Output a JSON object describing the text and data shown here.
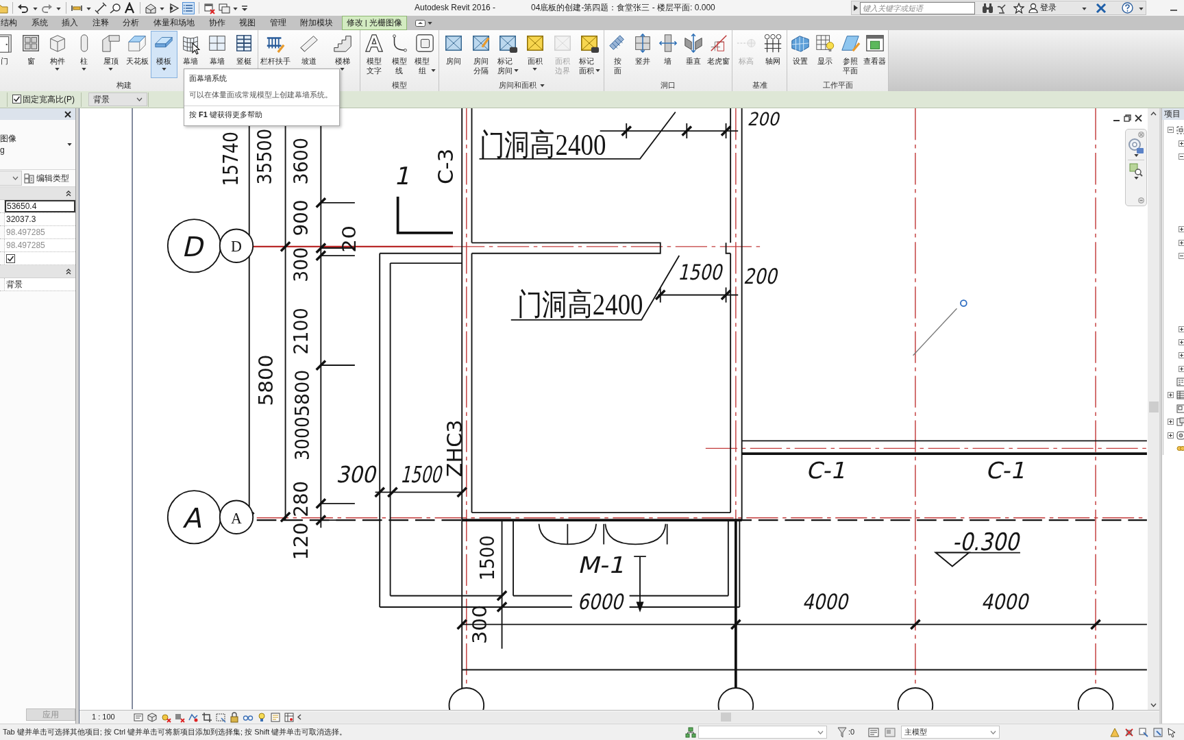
{
  "title_bar": {
    "app": "Autodesk Revit 2016 -",
    "document": "04底板的创建-第四题：食堂张三 - 楼层平面: 0.000",
    "search": {
      "placeholder": "键入关键字或短语"
    },
    "sign_in": "登录"
  },
  "ribbon_tabs": [
    {
      "label": "结构",
      "selected": false
    },
    {
      "label": "系统",
      "selected": false
    },
    {
      "label": "插入",
      "selected": false
    },
    {
      "label": "注释",
      "selected": false
    },
    {
      "label": "分析",
      "selected": false
    },
    {
      "label": "体量和场地",
      "selected": false
    },
    {
      "label": "协作",
      "selected": false
    },
    {
      "label": "视图",
      "selected": false
    },
    {
      "label": "管理",
      "selected": false
    },
    {
      "label": "附加模块",
      "selected": false
    },
    {
      "label": "修改 | 光栅图像",
      "selected": true
    }
  ],
  "ribbon_panels": [
    {
      "title": "构建",
      "has_menu": false,
      "tools": [
        {
          "label": "门",
          "has_menu": false,
          "highlighted": false,
          "disabled": false
        },
        {
          "label": "窗",
          "has_menu": false,
          "highlighted": false,
          "disabled": false
        },
        {
          "label": "构件",
          "has_menu": true,
          "highlighted": false,
          "disabled": false
        },
        {
          "label": "柱",
          "has_menu": true,
          "highlighted": false,
          "disabled": false
        },
        {
          "label": "屋顶",
          "has_menu": true,
          "highlighted": false,
          "disabled": false
        },
        {
          "label": "天花板",
          "has_menu": false,
          "highlighted": false,
          "disabled": false
        },
        {
          "label": "楼板",
          "has_menu": true,
          "highlighted": true,
          "disabled": false
        },
        {
          "label": "幕墙",
          "has_menu": false,
          "highlighted": false,
          "disabled": false
        },
        {
          "label": "幕墙",
          "has_menu": false,
          "highlighted": false,
          "disabled": false
        },
        {
          "label": "竖梃",
          "has_menu": false,
          "highlighted": false,
          "disabled": false
        }
      ]
    },
    {
      "tools": [
        {
          "label": "栏杆扶手",
          "has_menu": false,
          "highlighted": false,
          "disabled": false
        },
        {
          "label": "坡道",
          "has_menu": false,
          "highlighted": false,
          "disabled": false
        },
        {
          "label": "楼梯",
          "has_menu": true,
          "highlighted": false,
          "disabled": false
        }
      ]
    },
    {
      "title": "模型",
      "has_menu": false,
      "tools": [
        {
          "label": "模型文字",
          "has_menu": false,
          "highlighted": false,
          "disabled": false
        },
        {
          "label": "模型线",
          "has_menu": false,
          "highlighted": false,
          "disabled": false
        },
        {
          "label": "模型组",
          "has_menu": true,
          "highlighted": false,
          "disabled": false
        }
      ]
    },
    {
      "title": "房间和面积",
      "has_menu": true,
      "tools": [
        {
          "label": "房间",
          "has_menu": false,
          "highlighted": false,
          "disabled": false
        },
        {
          "label": "房间分隔",
          "has_menu": false,
          "highlighted": false,
          "disabled": false
        },
        {
          "label": "标记房间",
          "has_menu": true,
          "highlighted": false,
          "disabled": false
        },
        {
          "label": "面积",
          "has_menu": true,
          "highlighted": false,
          "disabled": false
        },
        {
          "label": "面积边界",
          "has_menu": false,
          "highlighted": false,
          "disabled": true
        },
        {
          "label": "标记面积",
          "has_menu": true,
          "highlighted": false,
          "disabled": false
        }
      ]
    },
    {
      "title": "洞口",
      "has_menu": false,
      "tools": [
        {
          "label": "按面",
          "has_menu": false,
          "highlighted": false,
          "disabled": false
        },
        {
          "label": "竖井",
          "has_menu": false,
          "highlighted": false,
          "disabled": false
        },
        {
          "label": "墙",
          "has_menu": false,
          "highlighted": false,
          "disabled": false
        },
        {
          "label": "垂直",
          "has_menu": false,
          "highlighted": false,
          "disabled": false
        },
        {
          "label": "老虎窗",
          "has_menu": false,
          "highlighted": false,
          "disabled": false
        }
      ]
    },
    {
      "title": "基准",
      "has_menu": false,
      "tools": [
        {
          "label": "标高",
          "has_menu": false,
          "highlighted": false,
          "disabled": true
        },
        {
          "label": "轴网",
          "has_menu": false,
          "highlighted": false,
          "disabled": false
        }
      ]
    },
    {
      "title": "工作平面",
      "has_menu": false,
      "tools": [
        {
          "label": "设置",
          "has_menu": false,
          "highlighted": false,
          "disabled": false
        },
        {
          "label": "显示",
          "has_menu": false,
          "highlighted": false,
          "disabled": false
        },
        {
          "label": "参照平面",
          "has_menu": false,
          "highlighted": false,
          "disabled": false
        },
        {
          "label": "查看器",
          "has_menu": false,
          "highlighted": false,
          "disabled": false
        }
      ]
    }
  ],
  "tooltip": {
    "title": "面幕墙系统",
    "description": "可以在体量面或常规模型上创建幕墙系统。",
    "help": "按 **F1** 键获得更多帮助"
  },
  "options_bar": {
    "lock_aspect": {
      "label": "固定宽高比(P)",
      "checked": true
    },
    "draw_layer": {
      "value": "背景"
    }
  },
  "properties": {
    "type_lines": [
      "图像",
      "g"
    ],
    "edit_type": "编辑类型",
    "groups": [
      {
        "expanded": true,
        "rows": [
          {
            "kind": "value",
            "value": "53650.4",
            "focused": true,
            "disabled": false
          },
          {
            "kind": "value",
            "value": "32037.3",
            "focused": false,
            "disabled": false
          },
          {
            "kind": "value",
            "value": "98.497285",
            "focused": false,
            "disabled": true
          },
          {
            "kind": "value",
            "value": "98.497285",
            "focused": false,
            "disabled": true
          },
          {
            "kind": "checkbox",
            "checked": true
          }
        ]
      },
      {
        "expanded": true,
        "rows": [
          {
            "kind": "value",
            "value": "背景",
            "focused": false,
            "disabled": false
          }
        ]
      }
    ],
    "apply": {
      "label": "应用",
      "disabled": true
    }
  },
  "floor_plan": {
    "texts": [
      {
        "kind": "dimension",
        "text": "200"
      },
      {
        "kind": "dimension",
        "text": "15740"
      },
      {
        "kind": "dimension",
        "text": "35500"
      },
      {
        "kind": "dimension",
        "text": "3600"
      },
      {
        "kind": "section",
        "text": "1"
      },
      {
        "kind": "mark",
        "text": "C-3"
      },
      {
        "kind": "note",
        "text": "门洞高2400"
      },
      {
        "kind": "dimension",
        "text": "900"
      },
      {
        "kind": "grid",
        "text": "D"
      },
      {
        "kind": "grid_small",
        "text": "D"
      },
      {
        "kind": "dimension",
        "text": "20"
      },
      {
        "kind": "dimension",
        "text": "300"
      },
      {
        "kind": "dimension",
        "text": "1500"
      },
      {
        "kind": "dimension",
        "text": "200"
      },
      {
        "kind": "note",
        "text": "门洞高2400"
      },
      {
        "kind": "dimension",
        "text": "2100"
      },
      {
        "kind": "dimension",
        "text": "5800"
      },
      {
        "kind": "dimension",
        "text": "5800"
      },
      {
        "kind": "dimension",
        "text": "3000"
      },
      {
        "kind": "mark",
        "text": "ZHC3"
      },
      {
        "kind": "dimension",
        "text": "300"
      },
      {
        "kind": "dimension",
        "text": "1500"
      },
      {
        "kind": "mark",
        "text": "C-1"
      },
      {
        "kind": "mark",
        "text": "C-1"
      },
      {
        "kind": "dimension",
        "text": "280"
      },
      {
        "kind": "grid",
        "text": "A"
      },
      {
        "kind": "grid_small",
        "text": "A"
      },
      {
        "kind": "dimension",
        "text": "120"
      },
      {
        "kind": "elevation",
        "text": "-0.300"
      },
      {
        "kind": "dimension",
        "text": "1500"
      },
      {
        "kind": "mark",
        "text": "M-1"
      },
      {
        "kind": "dimension",
        "text": "6000"
      },
      {
        "kind": "dimension",
        "text": "4000"
      },
      {
        "kind": "dimension",
        "text": "4000"
      },
      {
        "kind": "dimension",
        "text": "300"
      }
    ]
  },
  "view_bar": {
    "scale": "1 : 100"
  },
  "project_browser": {
    "title": "项目",
    "nodes": [
      {
        "kind": "group",
        "expanded": true,
        "children": [
          {
            "kind": "group",
            "expanded": false
          },
          {
            "kind": "group",
            "expanded": true
          },
          {
            "kind": "group",
            "expanded": false
          },
          {
            "kind": "group",
            "expanded": false
          },
          {
            "kind": "group",
            "expanded": true
          },
          {
            "kind": "group",
            "expanded": false
          },
          {
            "kind": "group",
            "expanded": false
          },
          {
            "kind": "group",
            "expanded": false
          },
          {
            "kind": "group",
            "expanded": false
          }
        ]
      },
      {
        "kind": "item"
      },
      {
        "kind": "group",
        "expanded": false
      },
      {
        "kind": "item"
      },
      {
        "kind": "group",
        "expanded": false
      },
      {
        "kind": "group",
        "expanded": false
      },
      {
        "kind": "item"
      }
    ]
  },
  "status_bar": {
    "message": "Tab 键并单击可选择其他项目; 按 Ctrl 键并单击可将新项目添加到选择集; 按 Shift 键并单击可取消选择。",
    "filter_count": ":0",
    "model": "主模型"
  }
}
